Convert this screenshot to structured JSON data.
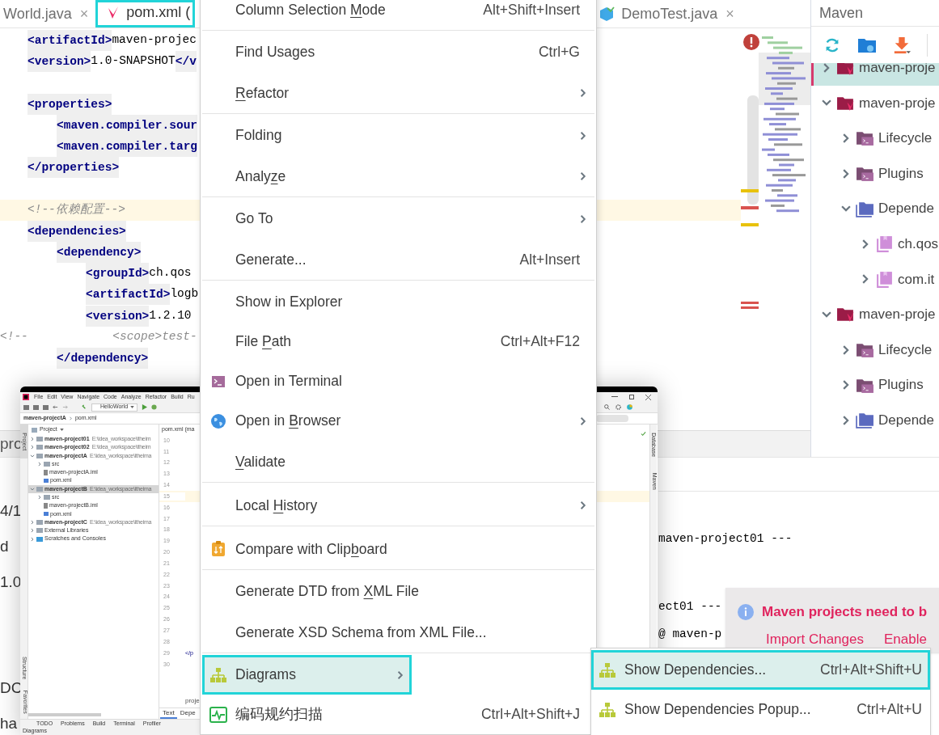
{
  "editor": {
    "tabs": [
      {
        "label": "World.java",
        "kind": "plain",
        "close": "×",
        "selected": false,
        "annotated": false
      },
      {
        "label": "pom.xml (",
        "kind": "maven",
        "selected": true,
        "annotated": true
      },
      {
        "label": "DemoTest.java",
        "kind": "test",
        "close": "×",
        "selected": false,
        "annotated": false
      }
    ],
    "lines": [
      {
        "kind": "code",
        "segments": [
          {
            "kind": "tag",
            "text": "<artifactId>"
          },
          {
            "kind": "value",
            "text": "maven-projec"
          }
        ]
      },
      {
        "kind": "code",
        "segments": [
          {
            "kind": "tag",
            "text": "<version>"
          },
          {
            "kind": "value",
            "text": "1.0-SNAPSHOT"
          },
          {
            "kind": "tag",
            "text": "</v"
          }
        ]
      },
      {
        "kind": "blank"
      },
      {
        "kind": "code",
        "segments": [
          {
            "kind": "tag",
            "text": "<properties>"
          }
        ],
        "children": [
          {
            "kind": "code",
            "segments": [
              {
                "kind": "tag",
                "text": "<maven.compiler.sour"
              }
            ]
          },
          {
            "kind": "code",
            "segments": [
              {
                "kind": "tag",
                "text": "<maven.compiler.targ"
              }
            ]
          }
        ]
      },
      {
        "kind": "code",
        "segments": [
          {
            "kind": "tag",
            "text": "</properties>"
          }
        ]
      },
      {
        "kind": "blank"
      },
      {
        "kind": "code",
        "current": true,
        "segments": [
          {
            "kind": "comment",
            "text": "<!--依赖配置-->"
          }
        ]
      },
      {
        "kind": "code",
        "segments": [
          {
            "kind": "tag",
            "text": "<dependencies>"
          }
        ],
        "children": [
          {
            "kind": "code",
            "segments": [
              {
                "kind": "tag",
                "text": "<dependency>"
              }
            ],
            "children": [
              {
                "kind": "code",
                "segments": [
                  {
                    "kind": "tag",
                    "text": "<groupId>"
                  },
                  {
                    "kind": "value",
                    "text": "ch.qos"
                  }
                ]
              },
              {
                "kind": "code",
                "segments": [
                  {
                    "kind": "tag",
                    "text": "<artifactId>"
                  },
                  {
                    "kind": "value",
                    "text": "logb"
                  }
                ]
              },
              {
                "kind": "code",
                "segments": [
                  {
                    "kind": "tag",
                    "text": "<version>"
                  },
                  {
                    "kind": "value",
                    "text": "1.2.10"
                  }
                ]
              },
              {
                "kind": "commented_out",
                "segments": [
                  {
                    "kind": "comment",
                    "text": "<!--            <scope>test-"
                  }
                ]
              }
            ]
          },
          {
            "kind": "code",
            "segments": [
              {
                "kind": "tag",
                "text": "</dependency>"
              }
            ]
          }
        ]
      }
    ]
  },
  "bottom_panel": {
    "tab": "pro",
    "left_lines": [
      "4/1",
      "d",
      "1.0",
      "DC",
      "ha"
    ],
    "console_lines": [
      "maven-project01 ---",
      "ect01 ---",
      "@ maven-p"
    ]
  },
  "maven_panel": {
    "title": "Maven",
    "tree": [
      {
        "label": "maven-proje",
        "kind": "project",
        "expanded": false,
        "selected": true
      },
      {
        "label": "maven-proje",
        "kind": "project",
        "expanded": true,
        "selected": false,
        "children": [
          {
            "label": "Lifecycle",
            "kind": "lifecycle",
            "expanded": false,
            "selected": false
          },
          {
            "label": "Plugins",
            "kind": "plugins",
            "expanded": false,
            "selected": false
          },
          {
            "label": "Depende",
            "kind": "dependencies",
            "expanded": true,
            "selected": false,
            "children": [
              {
                "label": "ch.qos",
                "kind": "library",
                "expanded": false,
                "selected": false
              },
              {
                "label": "com.it",
                "kind": "library",
                "expanded": false,
                "selected": false
              }
            ]
          }
        ]
      },
      {
        "label": "maven-proje",
        "kind": "project",
        "expanded": true,
        "selected": false,
        "children": [
          {
            "label": "Lifecycle",
            "kind": "lifecycle",
            "expanded": false,
            "selected": false
          },
          {
            "label": "Plugins",
            "kind": "plugins",
            "expanded": false,
            "selected": false
          },
          {
            "label": "Depende",
            "kind": "dependencies",
            "expanded": false,
            "selected": false
          }
        ]
      }
    ]
  },
  "inset_window": {
    "menu_bar": [
      "File",
      "Edit",
      "View",
      "Navigate",
      "Code",
      "Analyze",
      "Refactor",
      "Build",
      "Ru"
    ],
    "run_config": "HelloWorld",
    "breadcrumb": [
      "maven-projectA",
      "pom.xml"
    ],
    "side_tabs": [
      {
        "label": "Project",
        "selected": true
      },
      {
        "label": "Structure",
        "selected": false
      },
      {
        "label": "Favorites",
        "selected": false
      }
    ],
    "project_title": "Project",
    "tree": [
      {
        "label": "maven-project01",
        "path": "E:\\idea_workspace\\itheim",
        "kind": "module",
        "expanded": false,
        "selected": false
      },
      {
        "label": "maven-project02",
        "path": "E:\\idea_workspace\\itheim",
        "kind": "module",
        "expanded": false,
        "selected": false
      },
      {
        "label": "maven-projectA",
        "path": "E:\\idea_workspace\\itheima",
        "kind": "module",
        "expanded": true,
        "selected": false,
        "children": [
          {
            "label": "src",
            "kind": "folder",
            "expanded": false,
            "selected": false
          },
          {
            "label": "maven-projectA.iml",
            "kind": "iml",
            "selected": false
          },
          {
            "label": "pom.xml",
            "kind": "pom",
            "selected": false
          }
        ]
      },
      {
        "label": "maven-projectB",
        "path": "E:\\idea_workspace\\itheima",
        "kind": "module",
        "expanded": true,
        "selected": true,
        "children": [
          {
            "label": "src",
            "kind": "folder",
            "expanded": false,
            "selected": false
          },
          {
            "label": "maven-projectB.iml",
            "kind": "iml",
            "selected": false
          },
          {
            "label": "pom.xml",
            "kind": "pom",
            "selected": false
          }
        ]
      },
      {
        "label": "maven-projectC",
        "path": "E:\\idea_workspace\\itheima",
        "kind": "module",
        "expanded": false,
        "selected": false
      },
      {
        "label": "External Libraries",
        "kind": "libraries",
        "expanded": false,
        "selected": false
      },
      {
        "label": "Scratches and Consoles",
        "kind": "scratches",
        "expanded": false,
        "selected": false
      }
    ],
    "editor_tab": "pom.xml (ma",
    "line_numbers": [
      {
        "number": "10"
      },
      {
        "number": "11"
      },
      {
        "number": "12"
      },
      {
        "number": "13"
      },
      {
        "number": "14"
      },
      {
        "number": "15",
        "current": true
      },
      {
        "number": "16"
      },
      {
        "number": "17"
      },
      {
        "number": "18"
      },
      {
        "number": "19"
      },
      {
        "number": "20"
      },
      {
        "number": "21"
      },
      {
        "number": "22"
      },
      {
        "number": "23"
      },
      {
        "number": "24"
      },
      {
        "number": "25"
      },
      {
        "number": "26"
      },
      {
        "number": "27"
      },
      {
        "number": "28"
      },
      {
        "number": "29",
        "text": "</p"
      },
      {
        "number": "30"
      }
    ],
    "editor_footer": "proje",
    "editor_tabs": [
      {
        "label": "Text",
        "selected": true
      },
      {
        "label": "Depe",
        "selected": false
      }
    ],
    "tool_tabs": [
      "TODO",
      "Problems",
      "Build",
      "Terminal",
      "Profiler"
    ],
    "status": "Diagrams",
    "right_strip": [
      "Database",
      "Maven"
    ]
  },
  "context_menu": {
    "items": [
      {
        "label": [
          {
            "text": "Column Selection ",
            "underlined": false
          },
          {
            "text": "M",
            "underlined": true
          },
          {
            "text": "ode",
            "underlined": false
          }
        ],
        "shortcut": "Alt+Shift+Insert",
        "kind": "plain",
        "submenu": false,
        "selected": false,
        "annotated": false,
        "separator_after": true
      },
      {
        "label": [
          {
            "text": "Find Usages",
            "underlined": false
          }
        ],
        "shortcut": "Ctrl+G",
        "kind": "plain",
        "submenu": false,
        "selected": false,
        "annotated": false,
        "separator_after": false
      },
      {
        "label": [
          {
            "text": "R",
            "underlined": true
          },
          {
            "text": "efactor",
            "underlined": false
          }
        ],
        "kind": "plain",
        "submenu": true,
        "selected": false,
        "annotated": false,
        "separator_after": true
      },
      {
        "label": [
          {
            "text": "Folding",
            "underlined": false
          }
        ],
        "kind": "plain",
        "submenu": true,
        "selected": false,
        "annotated": false,
        "separator_after": false
      },
      {
        "label": [
          {
            "text": "Analy",
            "underlined": false
          },
          {
            "text": "z",
            "underlined": true
          },
          {
            "text": "e",
            "underlined": false
          }
        ],
        "kind": "plain",
        "submenu": true,
        "selected": false,
        "annotated": false,
        "separator_after": true
      },
      {
        "label": [
          {
            "text": "Go To",
            "underlined": false
          }
        ],
        "kind": "plain",
        "submenu": true,
        "selected": false,
        "annotated": false,
        "separator_after": false
      },
      {
        "label": [
          {
            "text": "Generate...",
            "underlined": false
          }
        ],
        "shortcut": "Alt+Insert",
        "kind": "plain",
        "submenu": false,
        "selected": false,
        "annotated": false,
        "separator_after": true
      },
      {
        "label": [
          {
            "text": "Show in Explorer",
            "underlined": false
          }
        ],
        "kind": "plain",
        "submenu": false,
        "selected": false,
        "annotated": false,
        "separator_after": false
      },
      {
        "label": [
          {
            "text": "File ",
            "underlined": false
          },
          {
            "text": "P",
            "underlined": true
          },
          {
            "text": "ath",
            "underlined": false
          }
        ],
        "shortcut": "Ctrl+Alt+F12",
        "kind": "plain",
        "submenu": false,
        "selected": false,
        "annotated": false,
        "separator_after": false
      },
      {
        "label": [
          {
            "text": "Open in Terminal",
            "underlined": false
          }
        ],
        "kind": "terminal",
        "submenu": false,
        "selected": false,
        "annotated": false,
        "separator_after": false
      },
      {
        "label": [
          {
            "text": "Open in ",
            "underlined": false
          },
          {
            "text": "B",
            "underlined": true
          },
          {
            "text": "rowser",
            "underlined": false
          }
        ],
        "kind": "browser",
        "submenu": true,
        "selected": false,
        "annotated": false,
        "separator_after": false
      },
      {
        "label": [
          {
            "text": "V",
            "underlined": true
          },
          {
            "text": "alidate",
            "underlined": false
          }
        ],
        "kind": "plain",
        "submenu": false,
        "selected": false,
        "annotated": false,
        "separator_after": true
      },
      {
        "label": [
          {
            "text": "Local ",
            "underlined": false
          },
          {
            "text": "H",
            "underlined": true
          },
          {
            "text": "istory",
            "underlined": false
          }
        ],
        "kind": "plain",
        "submenu": true,
        "selected": false,
        "annotated": false,
        "separator_after": true
      },
      {
        "label": [
          {
            "text": "Compare with Clip",
            "underlined": false
          },
          {
            "text": "b",
            "underlined": true
          },
          {
            "text": "oard",
            "underlined": false
          }
        ],
        "kind": "compare",
        "submenu": false,
        "selected": false,
        "annotated": false,
        "separator_after": true
      },
      {
        "label": [
          {
            "text": "Generate DTD from ",
            "underlined": false
          },
          {
            "text": "X",
            "underlined": true
          },
          {
            "text": "ML File",
            "underlined": false
          }
        ],
        "kind": "plain",
        "submenu": false,
        "selected": false,
        "annotated": false,
        "separator_after": false
      },
      {
        "label": [
          {
            "text": "Generate XSD Schema from XML File...",
            "underlined": false
          }
        ],
        "kind": "plain",
        "submenu": false,
        "selected": false,
        "annotated": false,
        "separator_after": true
      },
      {
        "label": [
          {
            "text": "Diagrams",
            "underlined": false
          }
        ],
        "kind": "diagram",
        "submenu": true,
        "selected": true,
        "annotated": true,
        "separator_after": false
      },
      {
        "label": [
          {
            "text": "编码规约扫描",
            "underlined": false
          }
        ],
        "shortcut": "Ctrl+Alt+Shift+J",
        "kind": "scan",
        "submenu": false,
        "selected": false,
        "annotated": false,
        "separator_after": false
      }
    ]
  },
  "submenu": {
    "items": [
      {
        "label": "Show Dependencies...",
        "shortcut": "Ctrl+Alt+Shift+U",
        "selected": true,
        "annotated": true
      },
      {
        "label": "Show Dependencies Popup...",
        "shortcut": "Ctrl+Alt+U",
        "selected": false,
        "annotated": false
      }
    ]
  },
  "notification": {
    "title": "Maven projects need to b",
    "links": [
      "Import Changes",
      "Enable"
    ]
  }
}
